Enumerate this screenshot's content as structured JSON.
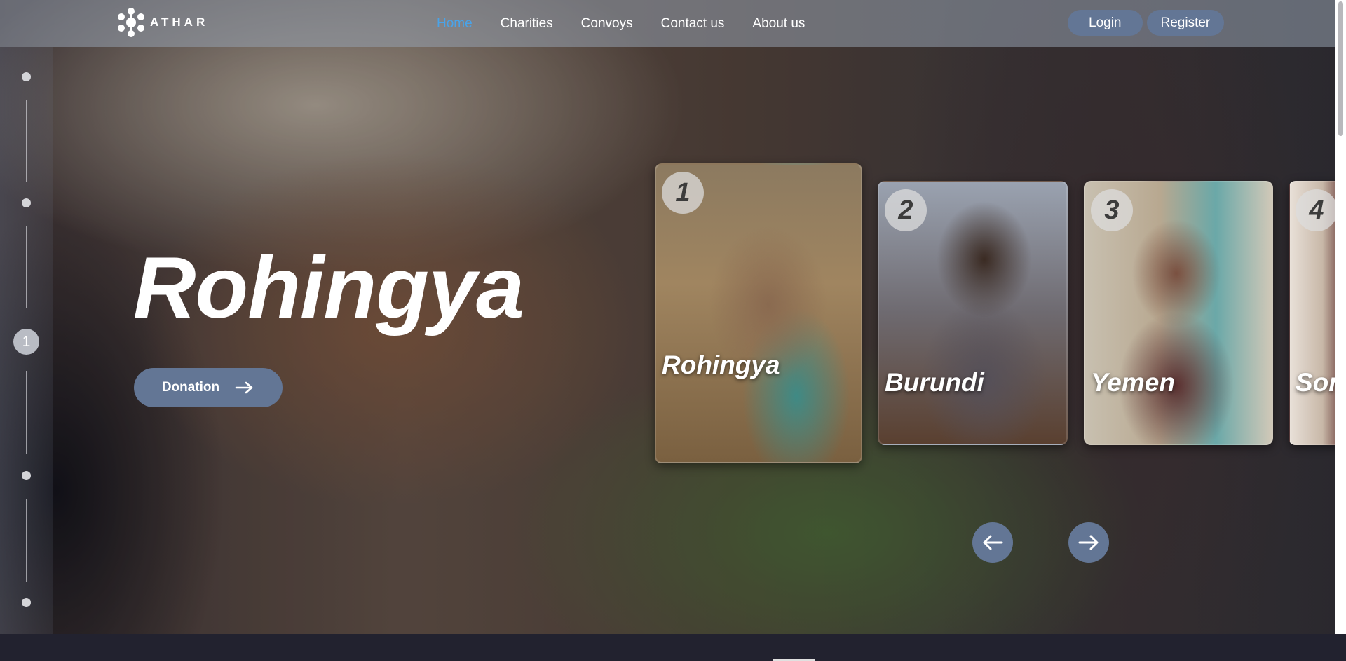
{
  "nav": {
    "logo_text": "ATHAR",
    "links": [
      "Home",
      "Charities",
      "Convoys",
      "Contact us",
      "About us"
    ],
    "active_index": 0,
    "login_label": "Login",
    "register_label": "Register"
  },
  "hero": {
    "title": "Rohingya",
    "donate_label": "Donation",
    "current_slide_number": "1"
  },
  "cards": [
    {
      "number": "1",
      "label": "Rohingya"
    },
    {
      "number": "2",
      "label": "Burundi"
    },
    {
      "number": "3",
      "label": "Yemen"
    },
    {
      "number": "4",
      "label": "Son"
    }
  ],
  "colors": {
    "accent": "#637695",
    "active_link": "#4aa3e8",
    "footer": "#22222f"
  },
  "icons": {
    "prev": "arrow-left-icon",
    "next": "arrow-right-icon",
    "donate": "arrow-right-icon",
    "logo": "athar-logo-icon"
  }
}
